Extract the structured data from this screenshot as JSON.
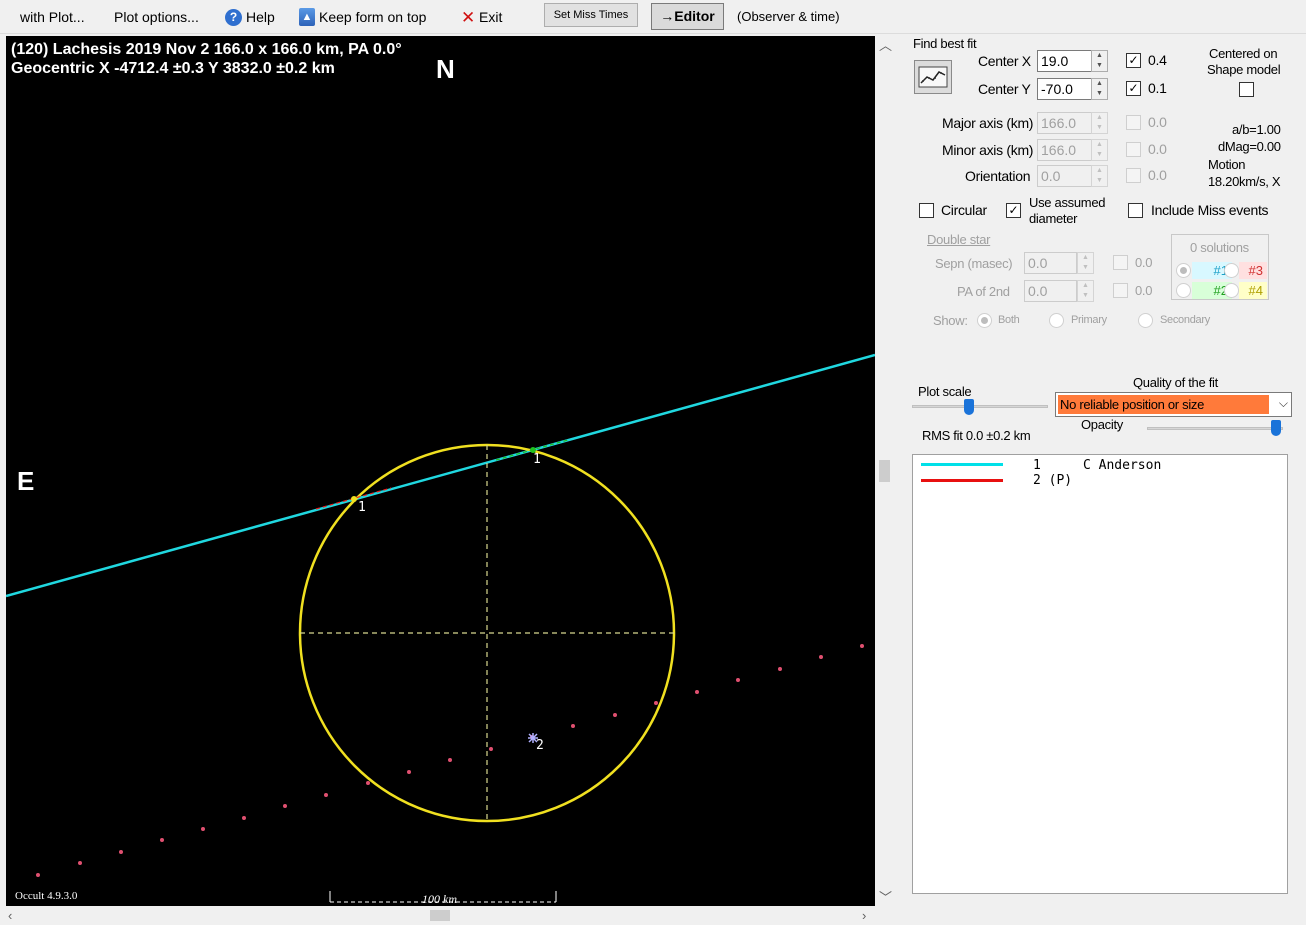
{
  "menu": {
    "with_plot": "with Plot...",
    "plot_options": "Plot options...",
    "help": "Help",
    "keep_on_top": "Keep form on top",
    "exit": "Exit",
    "set_miss_times": "Set Miss Times",
    "editor": "→Editor",
    "observer_time": "(Observer & time)"
  },
  "plot": {
    "title_line1": "(120) Lachesis  2019 Nov 2   166.0 x 166.0 km, PA 0.0°",
    "title_line2": "Geocentric  X  -4712.4 ±0.3  Y 3832.0 ±0.2 km",
    "north": "N",
    "east": "E",
    "chord_label_1a": "1",
    "chord_label_1b": "1",
    "chord_label_2": "2",
    "version": "Occult 4.9.3.0",
    "scale_label": "100 km"
  },
  "panel": {
    "find_best_fit": "Find best fit",
    "center_x_label": "Center X",
    "center_x_value": "19.0",
    "center_x_check": "0.4",
    "center_y_label": "Center Y",
    "center_y_value": "-70.0",
    "center_y_check": "0.1",
    "centered_on": "Centered on",
    "shape_model": "Shape model",
    "major_axis_label": "Major axis (km)",
    "major_axis_value": "166.0",
    "major_axis_check": "0.0",
    "minor_axis_label": "Minor axis (km)",
    "minor_axis_value": "166.0",
    "minor_axis_check": "0.0",
    "orientation_label": "Orientation",
    "orientation_value": "0.0",
    "orientation_check": "0.0",
    "ab_ratio": "a/b=1.00",
    "dmag": "dMag=0.00",
    "motion_label": "Motion",
    "motion_value": "18.20km/s, X",
    "circular": "Circular",
    "use_assumed_1": "Use assumed",
    "use_assumed_2": "diameter",
    "include_miss": "Include Miss events",
    "double_star": "Double star",
    "sepn_label": "Sepn (masec)",
    "sepn_value": "0.0",
    "sepn_check": "0.0",
    "pa2_label": "PA of 2nd",
    "pa2_value": "0.0",
    "pa2_check": "0.0",
    "show_label": "Show:",
    "show_both": "Both",
    "show_primary": "Primary",
    "show_secondary": "Secondary",
    "solutions": "0 solutions",
    "sol1": "#1",
    "sol2": "#2",
    "sol3": "#3",
    "sol4": "#4",
    "plot_scale": "Plot scale",
    "quality_label": "Quality of the fit",
    "quality_value": "No reliable position or size",
    "opacity": "Opacity",
    "rms_fit": "RMS fit 0.0 ±0.2 km"
  },
  "legend": {
    "entries": [
      {
        "num": "1",
        "observer": "C Anderson",
        "color": "#00e0e8"
      },
      {
        "num": "2 (P)",
        "observer": "",
        "color": "#e81010"
      }
    ]
  },
  "colors": {
    "ellipse": "#f0e020",
    "chord": "#20d8e0",
    "miss": "#e05070",
    "quality_bad": "#ff7a3a"
  }
}
